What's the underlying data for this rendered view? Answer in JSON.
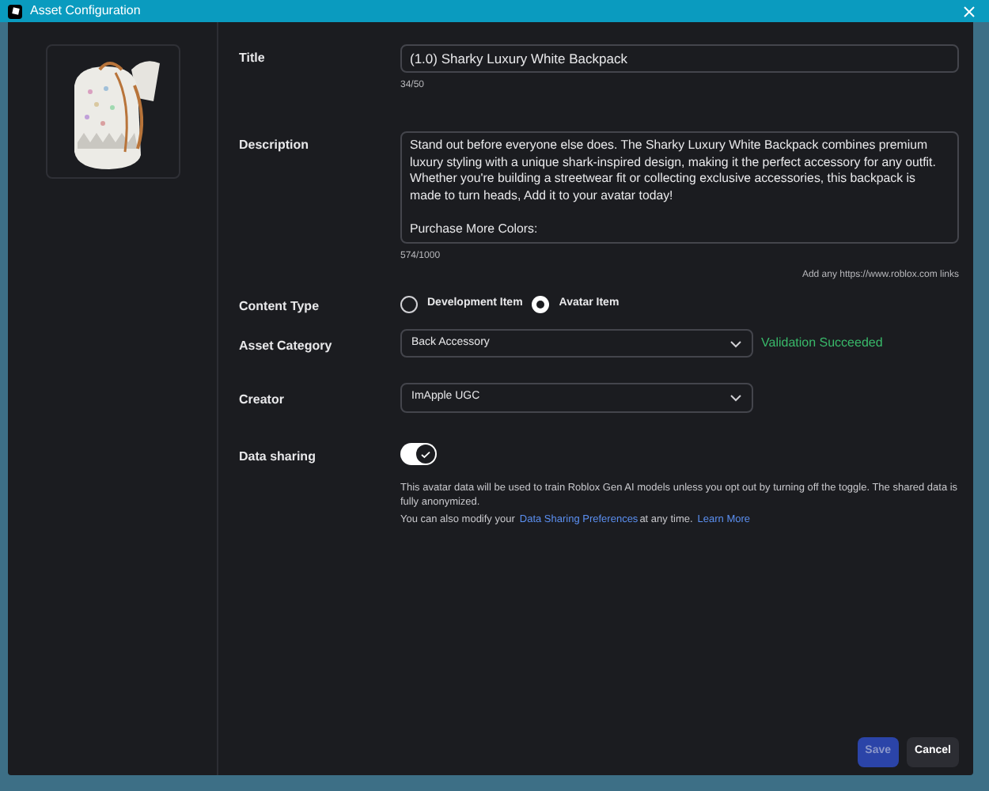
{
  "window": {
    "title": "Asset Configuration"
  },
  "title_field": {
    "label": "Title",
    "value": "(1.0) Sharky Luxury White Backpack",
    "counter": "34/50"
  },
  "description_field": {
    "label": "Description",
    "value": "Stand out before everyone else does. The Sharky Luxury White Backpack combines premium luxury styling with a unique shark-inspired design, making it the perfect accessory for any outfit. Whether you're building a streetwear fit or collecting exclusive accessories, this backpack is made to turn heads, Add it to your avatar today!\n\nPurchase More Colors:",
    "counter": "574/1000",
    "hint": "Add any https://www.roblox.com links"
  },
  "content_type": {
    "label": "Content Type",
    "options": [
      {
        "label": "Development Item",
        "selected": false
      },
      {
        "label": "Avatar Item",
        "selected": true
      }
    ]
  },
  "asset_category": {
    "label": "Asset Category",
    "value": "Back Accessory",
    "status": "Validation Succeeded"
  },
  "creator": {
    "label": "Creator",
    "value": "ImApple UGC"
  },
  "data_sharing": {
    "label": "Data sharing",
    "on": true,
    "notice": "This avatar data will be used to train Roblox Gen AI models unless you opt out by turning off the toggle. The shared data is fully anonymized.",
    "prefs_before": "You can also modify your",
    "prefs_link": "Data Sharing Preferences",
    "prefs_after": "at any time.",
    "learn_more": "Learn More"
  },
  "buttons": [
    {
      "label": "Save",
      "kind": "primary",
      "disabled": true
    },
    {
      "label": "Cancel",
      "kind": "secondary",
      "disabled": false
    }
  ]
}
